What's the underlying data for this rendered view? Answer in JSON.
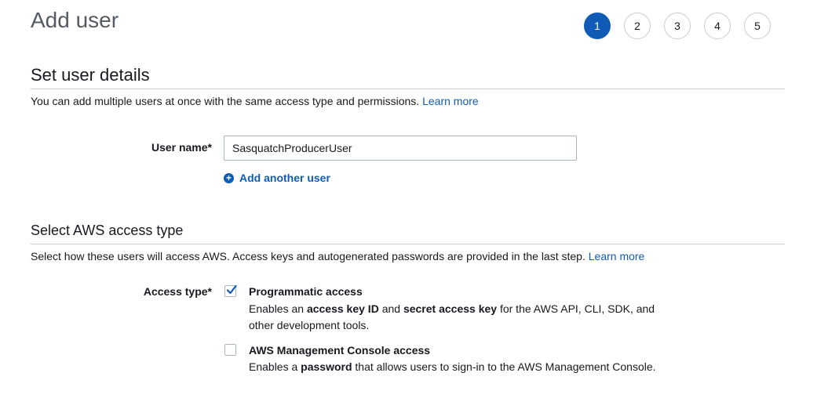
{
  "page": {
    "title": "Add user"
  },
  "steps": [
    "1",
    "2",
    "3",
    "4",
    "5"
  ],
  "active_step": "1",
  "details": {
    "heading": "Set user details",
    "description": "You can add multiple users at once with the same access type and permissions.",
    "learn_more": "Learn more",
    "username_label": "User name*",
    "username_value": "SasquatchProducerUser",
    "add_another_label": "Add another user"
  },
  "access": {
    "heading": "Select AWS access type",
    "description": "Select how these users will access AWS. Access keys and autogenerated passwords are provided in the last step.",
    "learn_more": "Learn more",
    "label": "Access type*",
    "programmatic": {
      "title": "Programmatic access",
      "checked": true,
      "desc_pre": "Enables an ",
      "desc_b1": "access key ID",
      "desc_mid": " and ",
      "desc_b2": "secret access key",
      "desc_post": " for the AWS API, CLI, SDK, and other development tools."
    },
    "console": {
      "title": "AWS Management Console access",
      "checked": false,
      "desc_pre": "Enables a ",
      "desc_b1": "password",
      "desc_post": " that allows users to sign-in to the AWS Management Console."
    }
  },
  "colors": {
    "accent": "#0f5bb5",
    "border": "#aab7b8"
  }
}
